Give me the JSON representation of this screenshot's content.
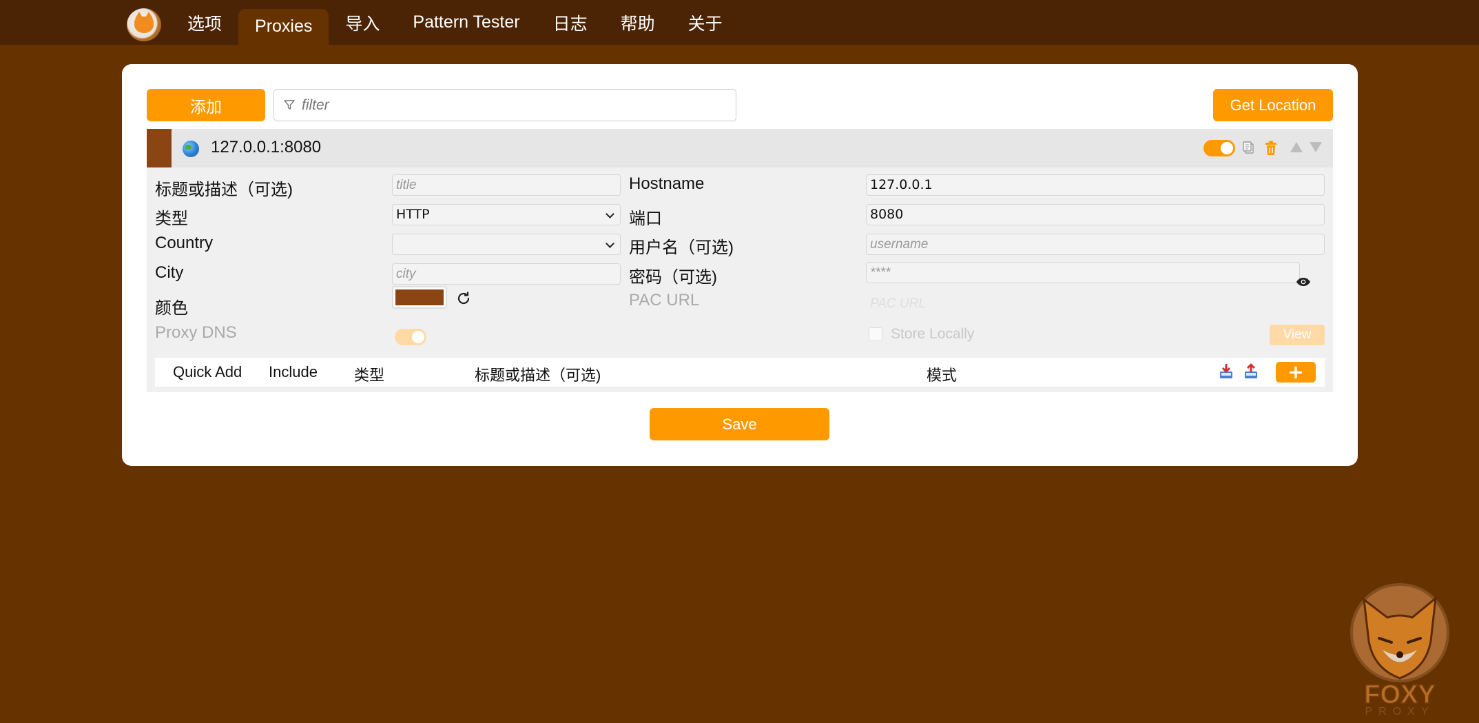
{
  "nav": {
    "tabs": [
      {
        "label": "选项"
      },
      {
        "label": "Proxies"
      },
      {
        "label": "导入"
      },
      {
        "label": "Pattern Tester"
      },
      {
        "label": "日志"
      },
      {
        "label": "帮助"
      },
      {
        "label": "关于"
      }
    ],
    "active_tab": "Proxies"
  },
  "toolbar": {
    "add_label": "添加",
    "filter_placeholder": "filter",
    "get_location_label": "Get Location"
  },
  "proxy": {
    "title": "127.0.0.1:8080",
    "color": "#8b4513",
    "enabled": true,
    "fields": {
      "title_label": "标题或描述（可选)",
      "title_placeholder": "title",
      "type_label": "类型",
      "type_value": "HTTP",
      "country_label": "Country",
      "country_value": "",
      "city_label": "City",
      "city_placeholder": "city",
      "color_label": "颜色",
      "proxy_dns_label": "Proxy DNS",
      "hostname_label": "Hostname",
      "hostname_value": "127.0.0.1",
      "port_label": "端口",
      "port_value": "8080",
      "username_label": "用户名（可选)",
      "username_placeholder": "username",
      "password_label": "密码（可选)",
      "password_placeholder": "****",
      "pac_url_label": "PAC URL",
      "pac_url_placeholder": "PAC URL",
      "store_locally_label": "Store Locally",
      "view_label": "View"
    },
    "patterns_header": {
      "quick_add": "Quick Add",
      "include": "Include",
      "type": "类型",
      "title": "标题或描述（可选)",
      "pattern": "模式",
      "add_label": "+"
    }
  },
  "save_label": "Save",
  "watermark": {
    "text": "FOXY",
    "subtext": "PROXY"
  },
  "colors": {
    "background": "#663300",
    "topbar": "#4a2405",
    "accent": "#ff9900",
    "proxy_color": "#8b4513"
  }
}
